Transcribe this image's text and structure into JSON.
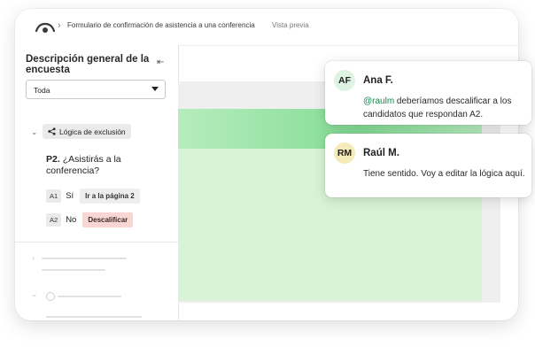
{
  "breadcrumb": {
    "survey_title": "Formulario de confirmación de asistencia a una conferencia",
    "preview_label": "Vista previa"
  },
  "sidebar": {
    "title": "Descripción general de la encuesta",
    "filter_value": "Toda",
    "logic_group_label": "Lógica de exclusión",
    "question_number": "P2.",
    "question_text": "¿Asistirás a la conferencia?",
    "answers": [
      {
        "code": "A1",
        "text": "Sí",
        "action": "Ir a la página 2"
      },
      {
        "code": "A2",
        "text": "No",
        "action": "Descalificar"
      }
    ]
  },
  "comments": [
    {
      "initials": "AF",
      "author": "Ana F.",
      "mention": "@raulm",
      "text": " deberíamos descalificar a los candidatos que respondan A2.",
      "avatar_color": "#dff3e2"
    },
    {
      "initials": "RM",
      "author": "Raúl M.",
      "text": "Tiene sentido. Voy a editar la lógica aquí.",
      "avatar_color": "#f4ebb8"
    }
  ],
  "colors": {
    "green_panel": "#d8f3d7",
    "mention": "#0a8a4a",
    "disqualify_bg": "#f9d6d3"
  }
}
